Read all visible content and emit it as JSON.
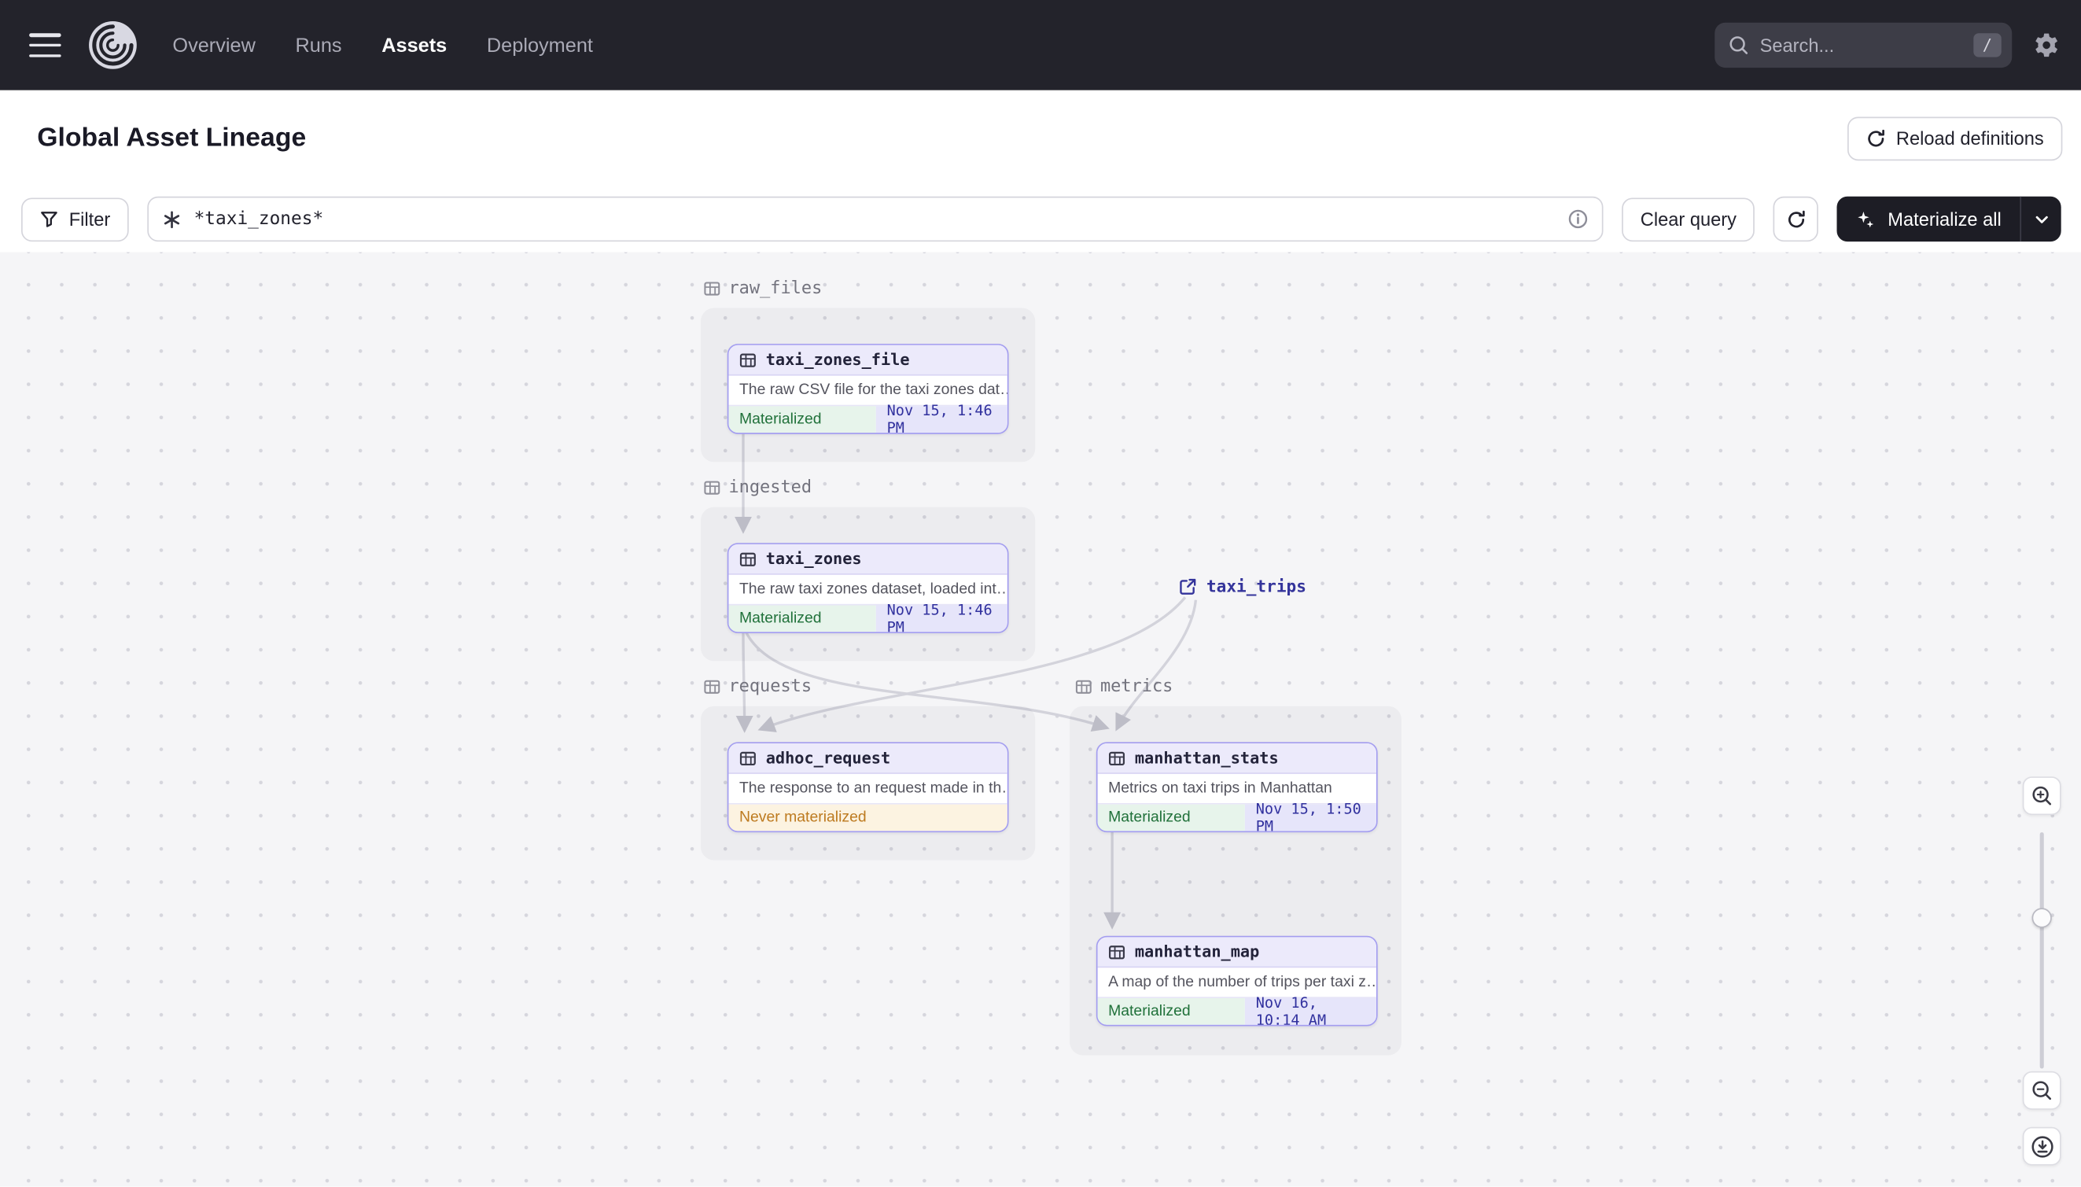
{
  "navbar": {
    "nav_items": [
      {
        "label": "Overview",
        "active": false
      },
      {
        "label": "Runs",
        "active": false
      },
      {
        "label": "Assets",
        "active": true
      },
      {
        "label": "Deployment",
        "active": false
      }
    ],
    "search_placeholder": "Search...",
    "search_shortcut": "/"
  },
  "header": {
    "title": "Global Asset Lineage",
    "reload_button_label": "Reload definitions"
  },
  "toolbar": {
    "filter_label": "Filter",
    "query_value": "*taxi_zones*",
    "clear_query_label": "Clear query",
    "materialize_all_label": "Materialize all"
  },
  "lineage": {
    "groups": [
      {
        "name": "raw_files"
      },
      {
        "name": "ingested"
      },
      {
        "name": "requests"
      },
      {
        "name": "metrics"
      }
    ],
    "external_asset": {
      "name": "taxi_trips"
    },
    "nodes": [
      {
        "name": "taxi_zones_file",
        "description": "The raw CSV file for the taxi zones dat…",
        "status": "Materialized",
        "timestamp": "Nov 15, 1:46 PM"
      },
      {
        "name": "taxi_zones",
        "description": "The raw taxi zones dataset, loaded int…",
        "status": "Materialized",
        "timestamp": "Nov 15, 1:46 PM"
      },
      {
        "name": "adhoc_request",
        "description": "The response to an request made in th…",
        "status": "Never materialized"
      },
      {
        "name": "manhattan_stats",
        "description": "Metrics on taxi trips in Manhattan",
        "status": "Materialized",
        "timestamp": "Nov 15, 1:50 PM"
      },
      {
        "name": "manhattan_map",
        "description": "A map of the number of trips per taxi z…",
        "status": "Materialized",
        "timestamp": "Nov 16, 10:14 AM"
      }
    ]
  },
  "colors": {
    "node_border": "#a39df0",
    "materialized_green": "#20713a",
    "never_materialized_orange": "#bd7a1f",
    "timestamp_blue": "#31319e",
    "navbar_bg": "#23232b"
  }
}
